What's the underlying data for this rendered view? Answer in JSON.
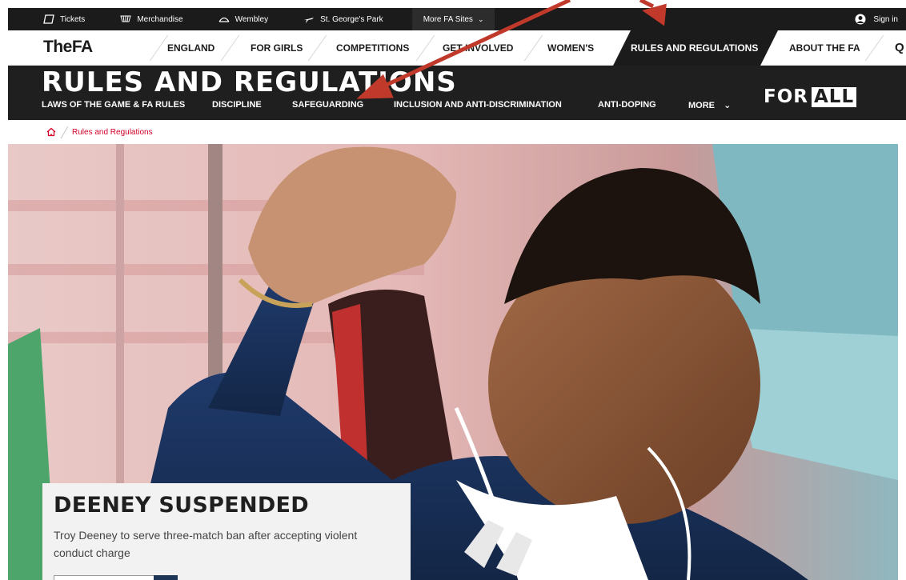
{
  "utility_bar": {
    "items": [
      {
        "label": "Tickets",
        "icon": "ticket-icon"
      },
      {
        "label": "Merchandise",
        "icon": "basket-icon"
      },
      {
        "label": "Wembley",
        "icon": "wembley-arch-icon"
      },
      {
        "label": "St. George's Park",
        "icon": "plane-icon"
      }
    ],
    "more_sites": "More FA Sites",
    "sign_in": "Sign in"
  },
  "main_nav": {
    "logo": "TheFA",
    "items": [
      "ENGLAND",
      "FOR GIRLS",
      "COMPETITIONS",
      "GET INVOLVED",
      "WOMEN'S",
      "RULES AND REGULATIONS",
      "ABOUT THE FA"
    ],
    "active": "RULES AND REGULATIONS",
    "search": "Q"
  },
  "section": {
    "title": "RULES AND REGULATIONS",
    "sub_nav": [
      "LAWS OF THE GAME & FA RULES",
      "DISCIPLINE",
      "SAFEGUARDING",
      "INCLUSION AND ANTI-DISCRIMINATION",
      "ANTI-DOPING",
      "MORE"
    ],
    "campaign_prefix": "FOR",
    "campaign_box": "ALL"
  },
  "breadcrumb": {
    "current": "Rules and Regulations"
  },
  "hero": {
    "headline": "DEENEY SUSPENDED",
    "summary": "Troy Deeney to serve three-match ban after accepting violent conduct charge"
  },
  "colors": {
    "accent_red": "#d3002a",
    "dark": "#1b1b1b",
    "annotation_arrow": "#c0392b"
  }
}
